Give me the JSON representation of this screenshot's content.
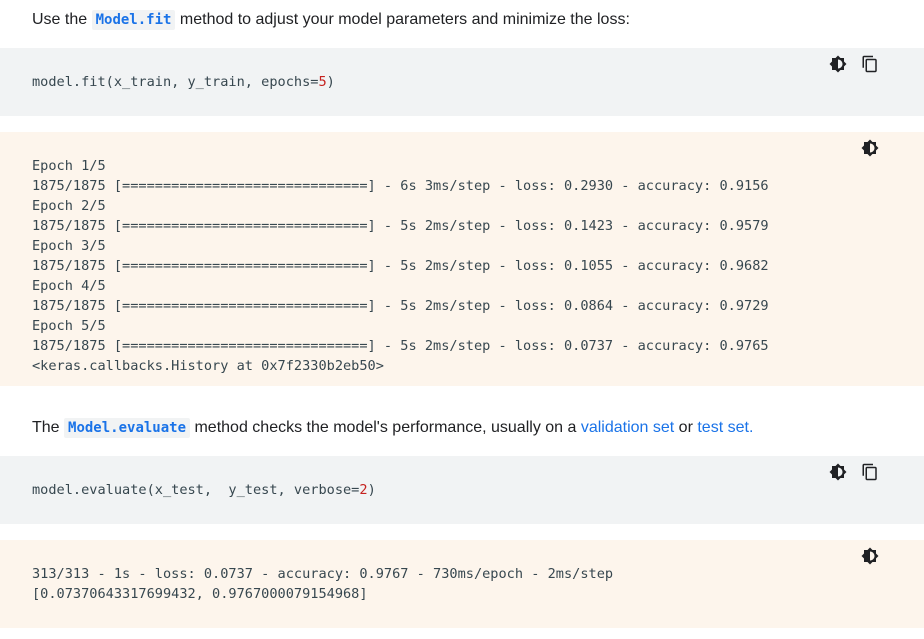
{
  "para1": {
    "before": "Use the ",
    "code": "Model.fit",
    "after": " method to adjust your model parameters and minimize the loss:"
  },
  "code1": {
    "prefix": "model.fit(x_train, y_train, epochs=",
    "number": "5",
    "suffix": ")"
  },
  "output1": {
    "lines": [
      "Epoch 1/5",
      "1875/1875 [==============================] - 6s 3ms/step - loss: 0.2930 - accuracy: 0.9156",
      "Epoch 2/5",
      "1875/1875 [==============================] - 5s 2ms/step - loss: 0.1423 - accuracy: 0.9579",
      "Epoch 3/5",
      "1875/1875 [==============================] - 5s 2ms/step - loss: 0.1055 - accuracy: 0.9682",
      "Epoch 4/5",
      "1875/1875 [==============================] - 5s 2ms/step - loss: 0.0864 - accuracy: 0.9729",
      "Epoch 5/5",
      "1875/1875 [==============================] - 5s 2ms/step - loss: 0.0737 - accuracy: 0.9765",
      "<keras.callbacks.History at 0x7f2330b2eb50>"
    ]
  },
  "para2": {
    "before": "The ",
    "code": "Model.evaluate",
    "middle": " method checks the model's performance, usually on a ",
    "link1": "validation set",
    "or": " or ",
    "link2": "test set",
    "end": "."
  },
  "code2": {
    "prefix": "model.evaluate(x_test,  y_test, verbose=",
    "number": "2",
    "suffix": ")"
  },
  "output2": {
    "lines": [
      "313/313 - 1s - loss: 0.0737 - accuracy: 0.9767 - 730ms/epoch - 2ms/step",
      "[0.07370643317699432, 0.9767000079154968]"
    ]
  },
  "icons": {
    "theme": "brightness-contrast-icon",
    "copy": "copy-icon"
  },
  "colors": {
    "link": "#1a73e8",
    "code_bg": "#f1f3f4",
    "output_bg": "#fdf5ec",
    "number": "#c5221f"
  }
}
